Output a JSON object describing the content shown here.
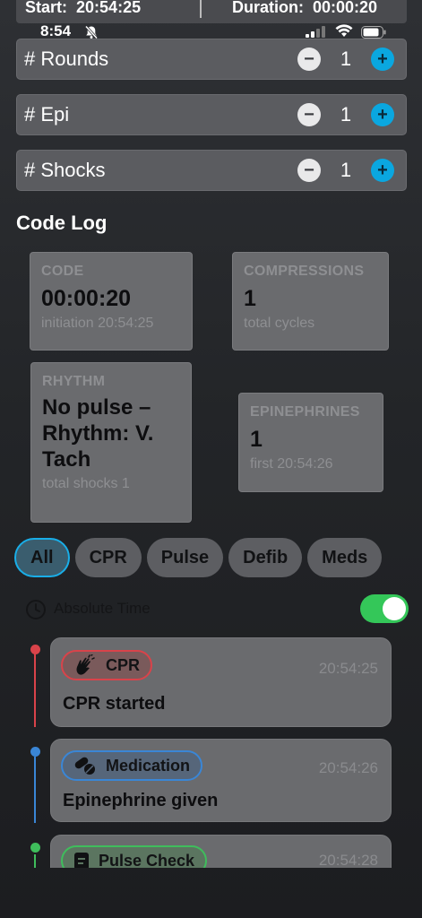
{
  "summary": {
    "start_label": "Start:",
    "start_value": "20:54:25",
    "duration_label": "Duration:",
    "duration_value": "00:00:20"
  },
  "status_bar": {
    "time": "8:54",
    "icons": [
      "bell-slash-icon",
      "cellular-signal-icon",
      "wifi-icon",
      "battery-icon"
    ]
  },
  "counters": [
    {
      "label": "# Rounds",
      "value": "1",
      "minus": "−",
      "plus": "+"
    },
    {
      "label": "# Epi",
      "value": "1",
      "minus": "−",
      "plus": "+"
    },
    {
      "label": "# Shocks",
      "value": "1",
      "minus": "−",
      "plus": "+"
    }
  ],
  "code_log": {
    "title": "Code Log",
    "cards": {
      "code": {
        "title": "CODE",
        "value": "00:00:20",
        "sub": "initiation 20:54:25"
      },
      "compressions": {
        "title": "COMPRESSIONS",
        "value": "1",
        "sub": "total cycles"
      },
      "rhythm": {
        "title": "RHYTHM",
        "value": "No pulse – Rhythm: V. Tach",
        "sub": "total shocks 1"
      },
      "epinephrines": {
        "title": "EPINEPHRINES",
        "value": "1",
        "sub": "first 20:54:26"
      }
    }
  },
  "filters": {
    "chips": [
      "All",
      "CPR",
      "Pulse",
      "Defib",
      "Meds"
    ],
    "selected": "All"
  },
  "absolute_time": {
    "label": "Absolute Time",
    "enabled": true
  },
  "events": [
    {
      "tag": "CPR",
      "time": "20:54:25",
      "description": "CPR started",
      "color": "#d9434a",
      "icon": "hands-clapping-icon"
    },
    {
      "tag": "Medication",
      "time": "20:54:26",
      "description": "Epinephrine given",
      "color": "#3a86d6",
      "icon": "pills-icon"
    },
    {
      "tag": "Pulse Check",
      "time": "20:54:28",
      "description": "",
      "color": "#3fbd5c",
      "icon": "clipboard-icon"
    }
  ],
  "colors": {
    "accent": "#19aee8",
    "toggle_on": "#34c759",
    "cpr": "#d9434a",
    "medication": "#3a86d6",
    "pulse": "#3fbd5c"
  }
}
